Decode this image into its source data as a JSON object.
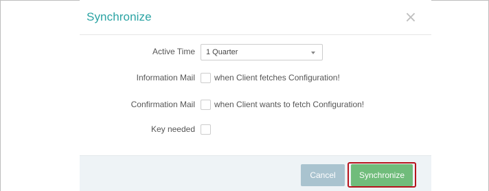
{
  "dialog": {
    "title": "Synchronize",
    "close_glyph": "×"
  },
  "form": {
    "active_time": {
      "label": "Active Time",
      "value": "1 Quarter"
    },
    "information_mail": {
      "label": "Information Mail",
      "text": "when Client fetches Configuration!",
      "checked": false
    },
    "confirmation_mail": {
      "label": "Confirmation Mail",
      "text": "when Client wants to fetch Configuration!",
      "checked": false
    },
    "key_needed": {
      "label": "Key needed",
      "checked": false
    }
  },
  "footer": {
    "cancel_label": "Cancel",
    "synchronize_label": "Synchronize"
  },
  "colors": {
    "title": "#2aa3a3",
    "cancel_button": "#a9c3cf",
    "synchronize_button": "#70bc7b",
    "highlight": "#b5121b",
    "footer_background": "#eef3f6"
  }
}
